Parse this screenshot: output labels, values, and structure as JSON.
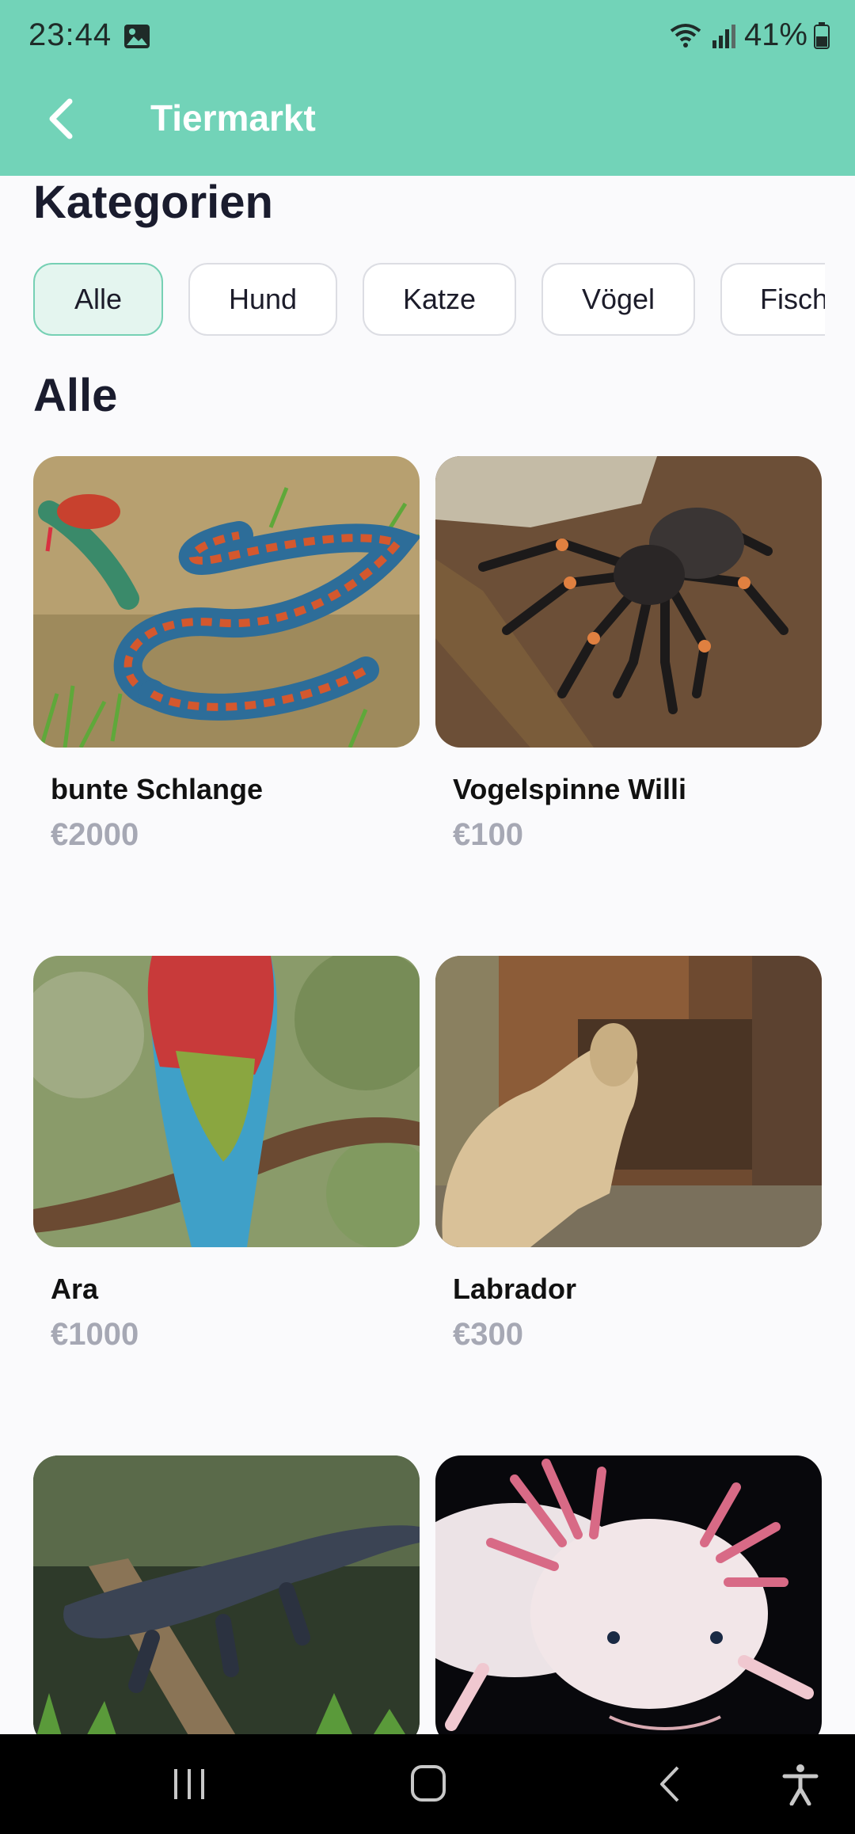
{
  "status_bar": {
    "time": "23:44",
    "battery": "41%"
  },
  "app_bar": {
    "title": "Tiermarkt"
  },
  "categories": {
    "heading": "Kategorien",
    "chips": [
      {
        "label": "Alle",
        "selected": true
      },
      {
        "label": "Hund",
        "selected": false
      },
      {
        "label": "Katze",
        "selected": false
      },
      {
        "label": "Vögel",
        "selected": false
      },
      {
        "label": "Fisch",
        "selected": false
      }
    ]
  },
  "listing": {
    "heading": "Alle",
    "items": [
      {
        "name": "bunte Schlange",
        "price": "€2000",
        "image": "snake-photo"
      },
      {
        "name": "Vogelspinne Willi",
        "price": "€100",
        "image": "tarantula-photo"
      },
      {
        "name": "Ara",
        "price": "€1000",
        "image": "macaw-photo"
      },
      {
        "name": "Labrador",
        "price": "€300",
        "image": "labrador-photo"
      },
      {
        "name": "",
        "price": "",
        "image": "alligator-photo"
      },
      {
        "name": "",
        "price": "",
        "image": "axolotl-photo"
      }
    ]
  },
  "colors": {
    "accent": "#72d3b8",
    "chip_selected_bg": "#e4f5ef",
    "price": "#a6a8b4"
  }
}
